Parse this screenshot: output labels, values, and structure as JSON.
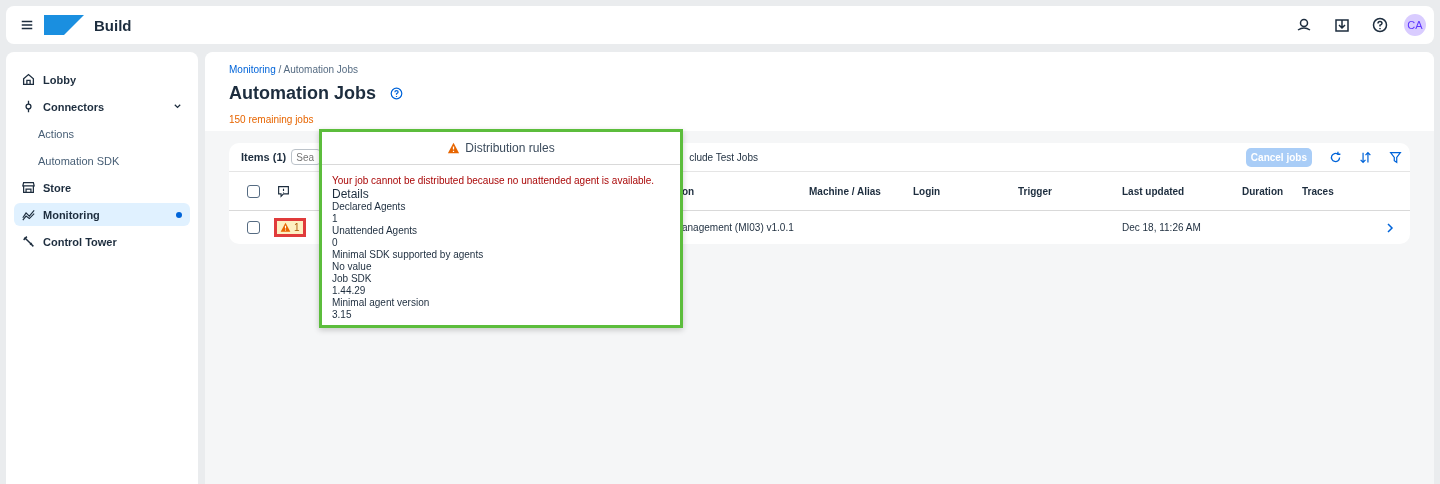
{
  "shell": {
    "product": "Build",
    "avatar": "CA"
  },
  "sidebar": {
    "items": [
      {
        "label": "Lobby",
        "selected": false
      },
      {
        "label": "Connectors",
        "selected": false,
        "expanded": true,
        "children": [
          {
            "label": "Actions"
          },
          {
            "label": "Automation SDK"
          }
        ]
      },
      {
        "label": "Store",
        "selected": false
      },
      {
        "label": "Monitoring",
        "selected": true
      },
      {
        "label": "Control Tower",
        "selected": false
      }
    ]
  },
  "breadcrumb": {
    "link": "Monitoring",
    "current": "/ Automation Jobs"
  },
  "page_title": "Automation Jobs",
  "remaining": "150 remaining jobs",
  "table": {
    "items_label": "Items (1)",
    "search_placeholder": "Sea",
    "test_jobs": "clude Test Jobs",
    "cancel_button": "Cancel jobs",
    "cancel_disabled": true,
    "all_checked": false,
    "columns": [
      "on",
      "Machine / Alias",
      "Login",
      "Trigger",
      "Last updated",
      "Duration",
      "Traces"
    ],
    "rows": [
      {
        "checked": false,
        "warning_count": "1",
        "cells": [
          "anagement (MI03) v1.0.1",
          "",
          "",
          "",
          "Dec 18, 11:26 AM",
          "",
          ""
        ]
      }
    ]
  },
  "popover": {
    "title": "Distribution rules",
    "message": "Your job cannot be distributed because no unattended agent is available.",
    "details_heading": "Details",
    "lines": [
      "Declared Agents",
      "1",
      "Unattended Agents",
      "0",
      "Minimal SDK supported by agents",
      "No value",
      "Job SDK",
      "1.44.29",
      "Minimal agent version",
      "3.15"
    ]
  }
}
